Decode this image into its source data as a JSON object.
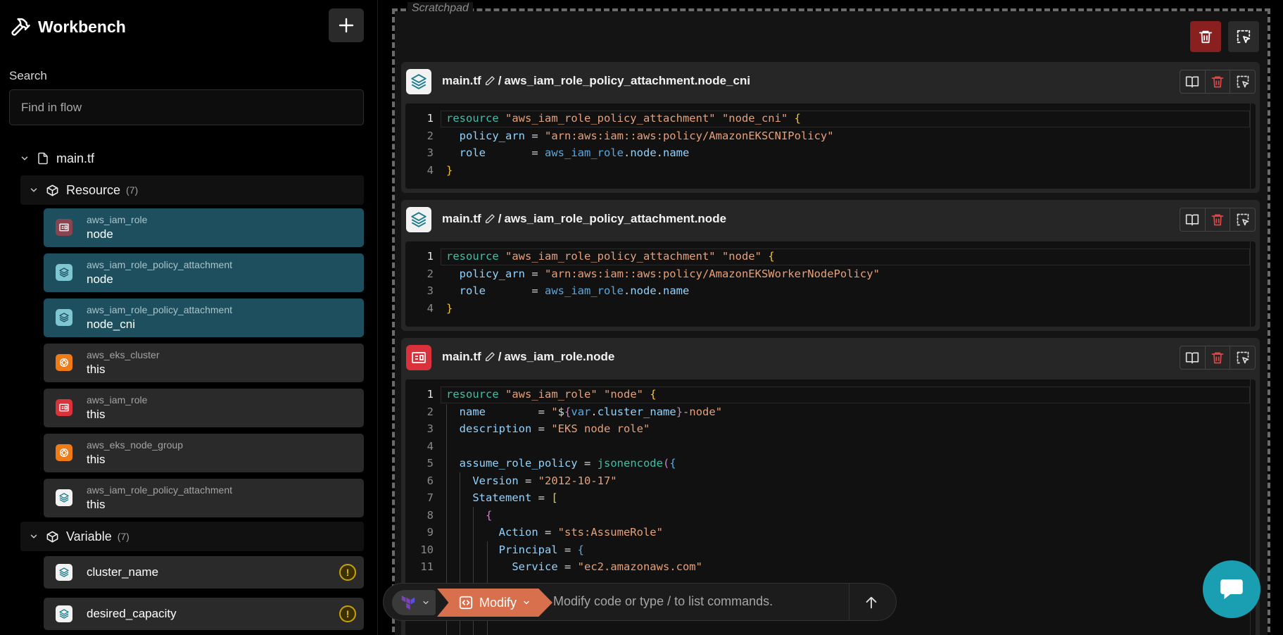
{
  "sidebar": {
    "title": "Workbench",
    "search": {
      "label": "Search",
      "placeholder": "Find in flow"
    },
    "file": "main.tf",
    "resource_group": {
      "label": "Resource",
      "count": "(7)",
      "items": [
        {
          "type": "aws_iam_role",
          "name": "node",
          "selected": true,
          "icon": "iam-role-icon"
        },
        {
          "type": "aws_iam_role_policy_attachment",
          "name": "node",
          "selected": true,
          "icon": "layers-icon"
        },
        {
          "type": "aws_iam_role_policy_attachment",
          "name": "node_cni",
          "selected": true,
          "icon": "layers-icon"
        },
        {
          "type": "aws_eks_cluster",
          "name": "this",
          "selected": false,
          "icon": "eks-icon"
        },
        {
          "type": "aws_iam_role",
          "name": "this",
          "selected": false,
          "icon": "iam-role-icon"
        },
        {
          "type": "aws_eks_node_group",
          "name": "this",
          "selected": false,
          "icon": "eks-icon"
        },
        {
          "type": "aws_iam_role_policy_attachment",
          "name": "this",
          "selected": false,
          "icon": "layers-icon"
        }
      ]
    },
    "variable_group": {
      "label": "Variable",
      "count": "(7)",
      "items": [
        {
          "name": "cluster_name",
          "warning": "!"
        },
        {
          "name": "desired_capacity",
          "warning": "!"
        }
      ]
    }
  },
  "scratchpad": {
    "label": "Scratchpad",
    "cards": [
      {
        "file": "main.tf",
        "sep": "/",
        "address": "aws_iam_role_policy_attachment.node_cni",
        "line_numbers": [
          "1",
          "2",
          "3",
          "4"
        ],
        "code": [
          "resource \"aws_iam_role_policy_attachment\" \"node_cni\" {",
          "  policy_arn = \"arn:aws:iam::aws:policy/AmazonEKSCNIPolicy\"",
          "  role       = aws_iam_role.node.name",
          "}"
        ]
      },
      {
        "file": "main.tf",
        "sep": "/",
        "address": "aws_iam_role_policy_attachment.node",
        "line_numbers": [
          "1",
          "2",
          "3",
          "4"
        ],
        "code": [
          "resource \"aws_iam_role_policy_attachment\" \"node\" {",
          "  policy_arn = \"arn:aws:iam::aws:policy/AmazonEKSWorkerNodePolicy\"",
          "  role       = aws_iam_role.node.name",
          "}"
        ]
      },
      {
        "file": "main.tf",
        "sep": "/",
        "address": "aws_iam_role.node",
        "line_numbers": [
          "1",
          "2",
          "3",
          "4",
          "5",
          "6",
          "7",
          "8",
          "9",
          "10",
          "11"
        ],
        "code": [
          "resource \"aws_iam_role\" \"node\" {",
          "  name        = \"${var.cluster_name}-node\"",
          "  description = \"EKS node role\"",
          "",
          "  assume_role_policy = jsonencode({",
          "    Version = \"2012-10-17\"",
          "    Statement = [",
          "      {",
          "        Action = \"sts:AssumeRole\"",
          "        Principal = {",
          "          Service = \"ec2.amazonaws.com\""
        ]
      }
    ]
  },
  "command_bar": {
    "mode": "Modify",
    "placeholder": "Modify code or type / to list commands."
  },
  "colors": {
    "selected_item": "#1d4f5e",
    "delete_red": "#8a1f1f",
    "modify_orange": "#d8704e",
    "chat_teal": "#1a9fb2"
  }
}
